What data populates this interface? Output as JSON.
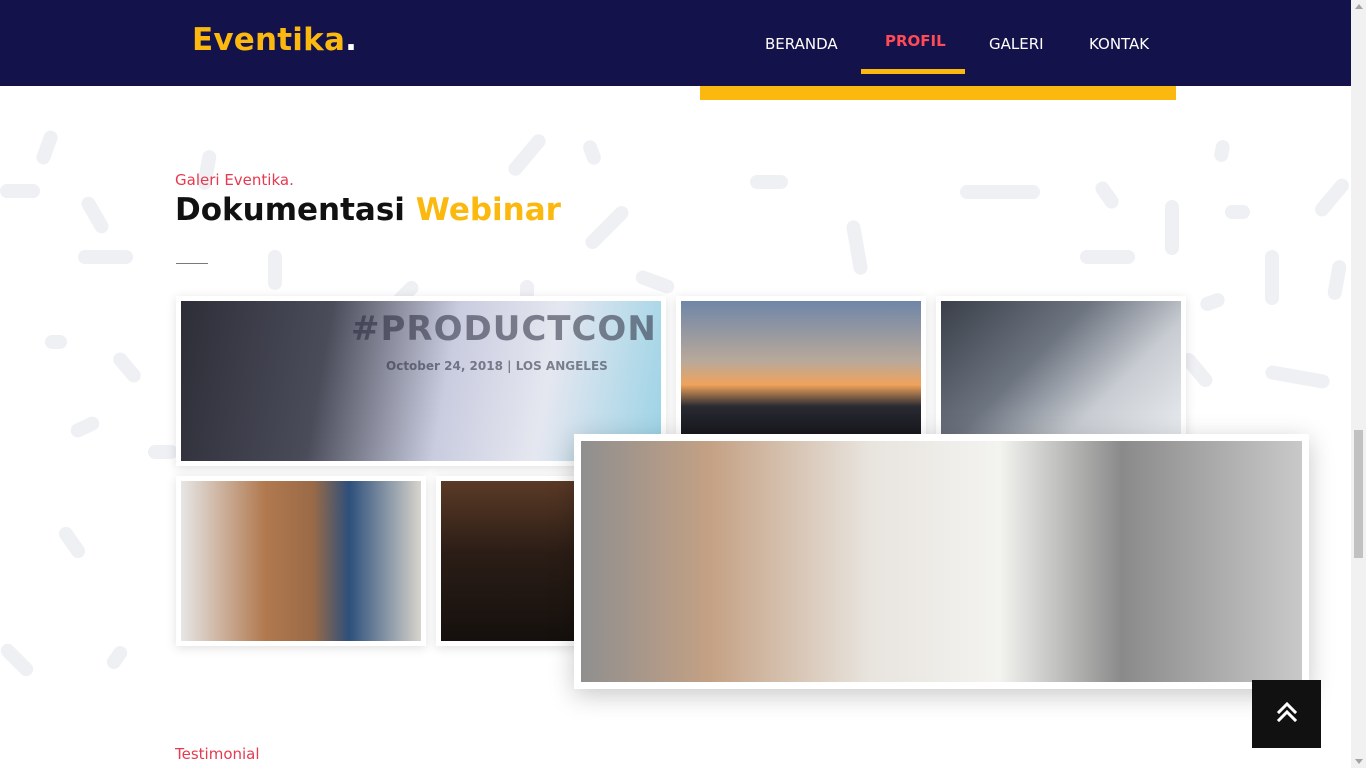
{
  "brand": {
    "name": "Eventika",
    "dot": "."
  },
  "nav": {
    "items": [
      {
        "label": "BERANDA"
      },
      {
        "label": "PROFIL",
        "active": true
      },
      {
        "label": "GALERI"
      },
      {
        "label": "KONTAK"
      }
    ]
  },
  "gallery": {
    "eyebrow": "Galeri Eventika.",
    "title_prefix": "Dokumentasi",
    "title_highlight": "Webinar",
    "photo_caption": "#PRODUCTCON",
    "photo_subcaption": "October 24, 2018 | LOS ANGELES"
  },
  "testimonial": {
    "eyebrow": "Testimonial"
  },
  "colors": {
    "navbar_bg": "#14124b",
    "accent_yellow": "#fbb80f",
    "accent_red": "#e53a4f",
    "back_to_top_bg": "#111111"
  },
  "icons": {
    "back_to_top": "double-chevron-up-icon"
  }
}
